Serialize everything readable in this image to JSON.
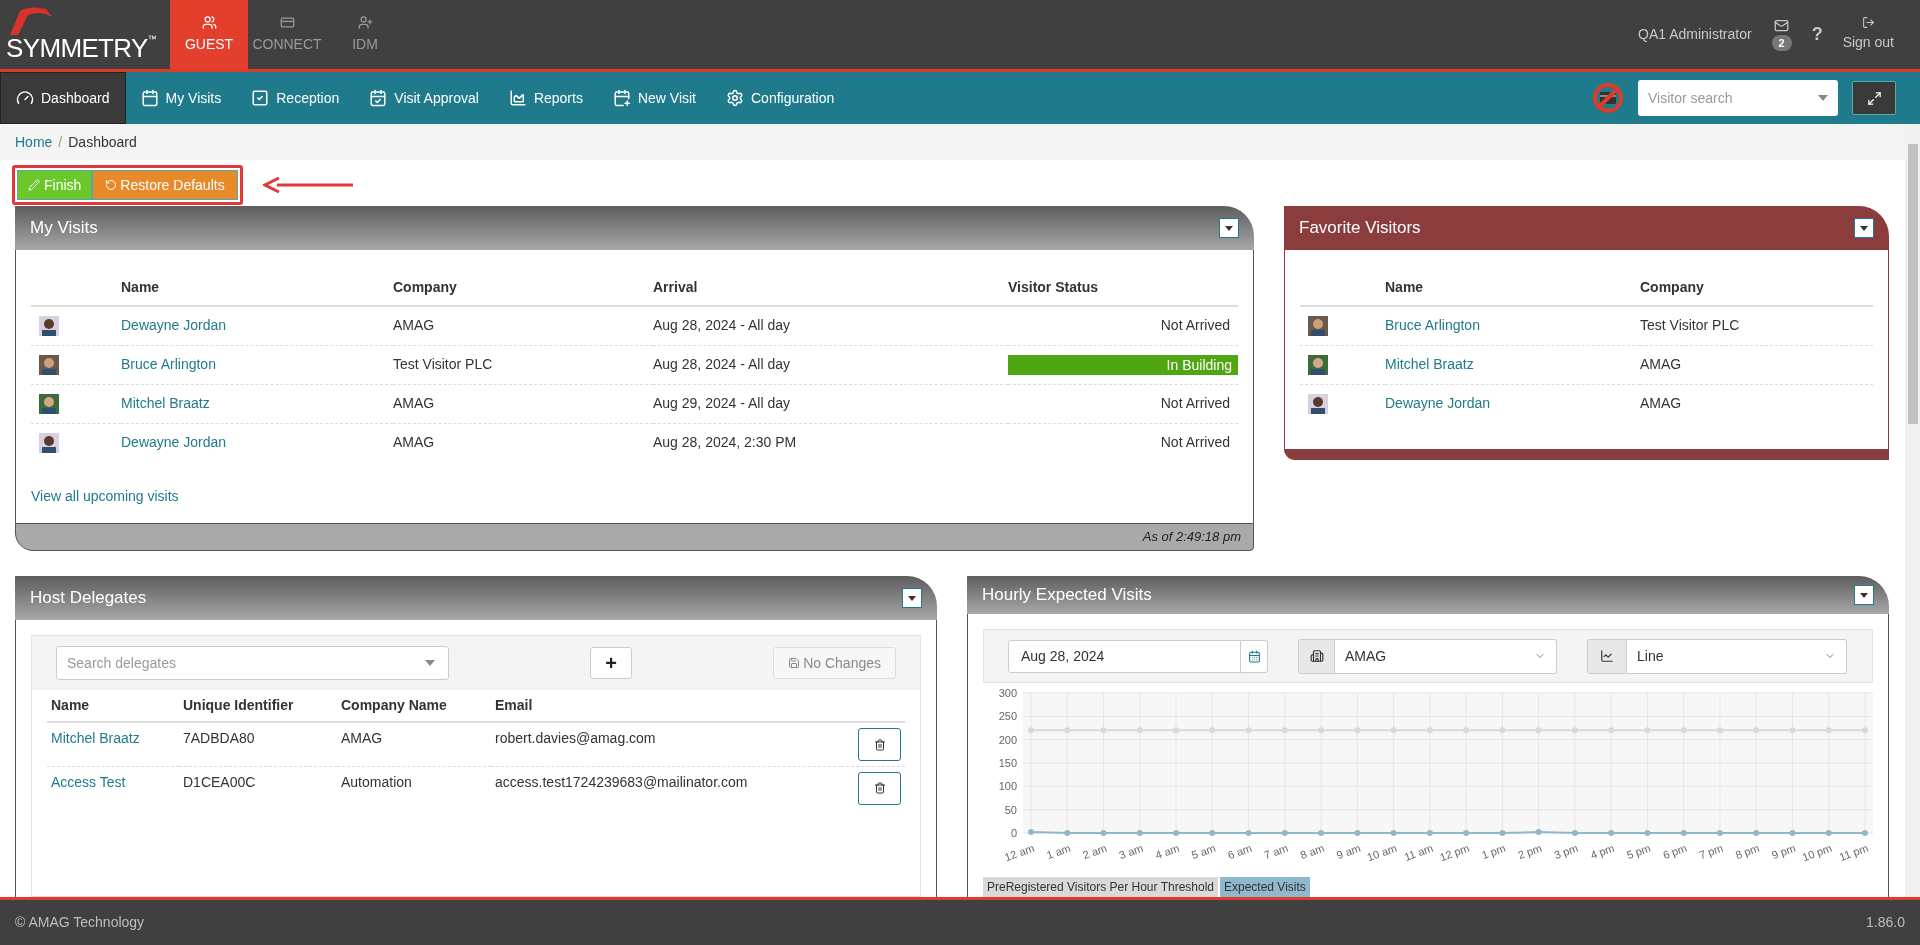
{
  "brand": {
    "logo": "SYMMETRY",
    "trademark": "™"
  },
  "apps": [
    {
      "label": "GUEST",
      "selected": true,
      "kind": "users"
    },
    {
      "label": "CONNECT",
      "selected": false,
      "kind": "card"
    },
    {
      "label": "IDM",
      "selected": false,
      "kind": "user-plus"
    }
  ],
  "user": {
    "name": "QA1 Administrator",
    "mail_count": "2",
    "help": "?",
    "sign_out": "Sign out"
  },
  "nav": [
    {
      "label": "Dashboard",
      "selected": true,
      "kind": "gauge"
    },
    {
      "label": "My Visits",
      "selected": false,
      "kind": "calendar"
    },
    {
      "label": "Reception",
      "selected": false,
      "kind": "check"
    },
    {
      "label": "Visit Approval",
      "selected": false,
      "kind": "calendar-check"
    },
    {
      "label": "Reports",
      "selected": false,
      "kind": "area"
    },
    {
      "label": "New Visit",
      "selected": false,
      "kind": "calendar-plus"
    },
    {
      "label": "Configuration",
      "selected": false,
      "kind": "gear"
    }
  ],
  "visitor_search": {
    "placeholder": "Visitor search"
  },
  "breadcrumb": [
    "Home",
    "Dashboard"
  ],
  "breadcrumb_separator": "/",
  "edit_buttons": {
    "finish": "Finish",
    "restore": "Restore Defaults"
  },
  "my_visits": {
    "title": "My Visits",
    "columns": [
      "Name",
      "Company",
      "Arrival",
      "Visitor Status"
    ],
    "rows": [
      {
        "name": "Dewayne Jordan",
        "company": "AMAG",
        "arrival": "Aug 28, 2024 - All day",
        "status": "Not Arrived",
        "highlighted": false
      },
      {
        "name": "Bruce Arlington",
        "company": "Test Visitor PLC",
        "arrival": "Aug 28, 2024 - All day",
        "status": "In Building",
        "highlighted": true
      },
      {
        "name": "Mitchel Braatz",
        "company": "AMAG",
        "arrival": "Aug 29, 2024 - All day",
        "status": "Not Arrived",
        "highlighted": false
      },
      {
        "name": "Dewayne Jordan",
        "company": "AMAG",
        "arrival": "Aug 28, 2024, 2:30 PM",
        "status": "Not Arrived",
        "highlighted": false
      }
    ],
    "link": "View all upcoming visits",
    "footer": "As of 2:49:18 pm"
  },
  "favorite_visitors": {
    "title": "Favorite Visitors",
    "columns": [
      "Name",
      "Company"
    ],
    "rows": [
      {
        "name": "Bruce Arlington",
        "company": "Test Visitor PLC"
      },
      {
        "name": "Mitchel Braatz",
        "company": "AMAG"
      },
      {
        "name": "Dewayne Jordan",
        "company": "AMAG"
      }
    ]
  },
  "host_delegates": {
    "title": "Host Delegates",
    "search_placeholder": "Search delegates",
    "add": "+",
    "save": "No Changes",
    "columns": [
      "Name",
      "Unique Identifier",
      "Company Name",
      "Email"
    ],
    "rows": [
      {
        "name": "Mitchel Braatz",
        "id": "7ADBDA80",
        "company": "AMAG",
        "email": "robert.davies@amag.com"
      },
      {
        "name": "Access Test",
        "id": "D1CEA00C",
        "company": "Automation",
        "email": "access.test1724239683@mailinator.com"
      }
    ]
  },
  "hourly": {
    "title": "Hourly Expected Visits",
    "date": "Aug 28, 2024",
    "site": "AMAG",
    "chart_type": "Line",
    "chart_data": {
      "type": "line",
      "categories": [
        "12 am",
        "1 am",
        "2 am",
        "3 am",
        "4 am",
        "5 am",
        "6 am",
        "7 am",
        "8 am",
        "9 am",
        "10 am",
        "11 am",
        "12 pm",
        "1 pm",
        "2 pm",
        "3 pm",
        "4 pm",
        "5 pm",
        "6 pm",
        "7 pm",
        "8 pm",
        "9 pm",
        "10 pm",
        "11 pm"
      ],
      "ylim": [
        0,
        300
      ],
      "yticks": [
        0,
        50,
        100,
        150,
        200,
        250,
        300
      ],
      "series": [
        {
          "name": "PreRegistered Visitors Per Hour Threshold",
          "color": "#d9d9d9",
          "marker": true,
          "values": [
            220,
            220,
            220,
            220,
            220,
            220,
            220,
            220,
            220,
            220,
            220,
            220,
            220,
            220,
            220,
            220,
            220,
            220,
            220,
            220,
            220,
            220,
            220,
            220
          ]
        },
        {
          "name": "Expected Visits",
          "color": "#8fb8cc",
          "marker": true,
          "values": [
            2,
            0,
            0,
            0,
            0,
            0,
            0,
            0,
            0,
            0,
            0,
            0,
            0,
            0,
            2,
            0,
            0,
            0,
            0,
            0,
            0,
            0,
            0,
            0
          ]
        }
      ]
    }
  },
  "footer": {
    "copyright": "© AMAG Technology",
    "version": "1.86.0"
  }
}
